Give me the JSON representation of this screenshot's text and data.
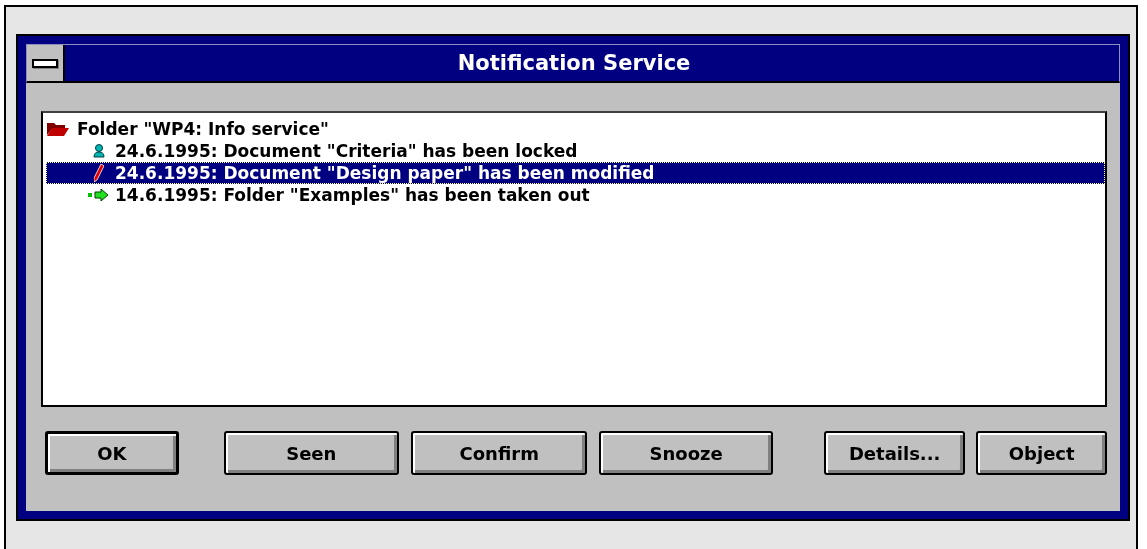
{
  "window": {
    "title": "Notification Service"
  },
  "list": {
    "items": [
      {
        "kind": "folder",
        "text": "Folder \"WP4: Info service\"",
        "selected": false,
        "children": [
          {
            "kind": "locked",
            "text": "24.6.1995: Document \"Criteria\" has been locked",
            "selected": false
          },
          {
            "kind": "modified",
            "text": "24.6.1995: Document \"Design paper\" has been modified",
            "selected": true
          },
          {
            "kind": "taken_out",
            "text": "14.6.1995: Folder \"Examples\" has been taken out",
            "selected": false
          }
        ]
      }
    ]
  },
  "buttons": [
    {
      "label": "OK",
      "default": true
    },
    {
      "label": "Seen",
      "default": false
    },
    {
      "label": "Confirm",
      "default": false
    },
    {
      "label": "Snooze",
      "default": false
    },
    {
      "label": "Details...",
      "default": false
    },
    {
      "label": "Object",
      "default": false
    }
  ]
}
